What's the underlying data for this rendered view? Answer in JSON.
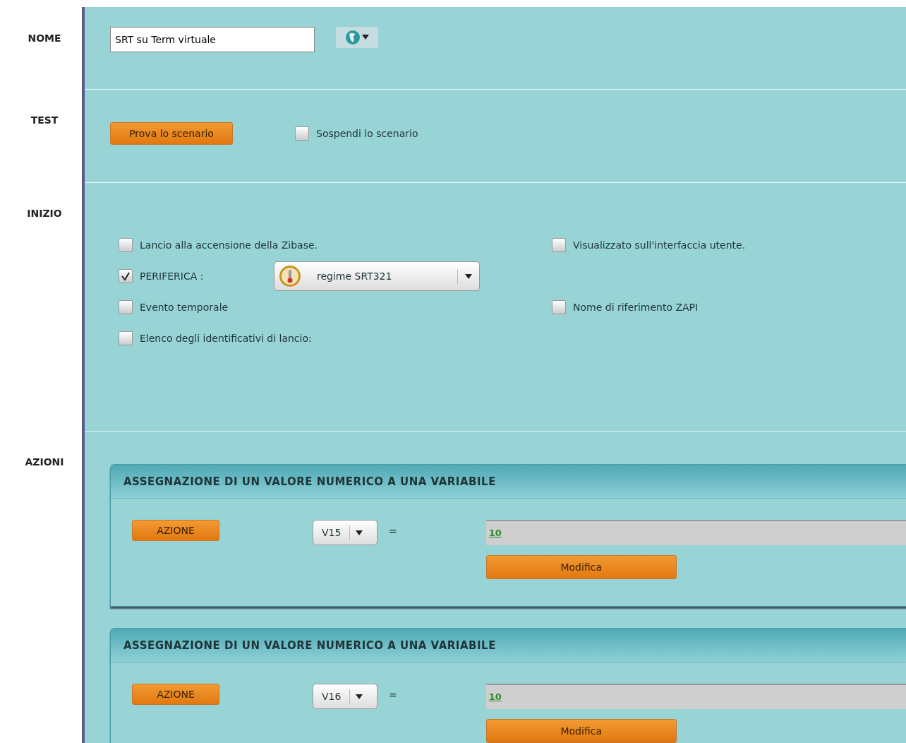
{
  "nome": {
    "label": "NOME",
    "value": "SRT su Term virtuale"
  },
  "test": {
    "label": "TEST",
    "button": "Prova lo scenario",
    "suspend": {
      "label": "Sospendi lo scenario",
      "checked": false
    }
  },
  "inizio": {
    "label": "INIZIO",
    "rows": [
      [
        {
          "kind": "plain",
          "label": "Lancio alla accensione della Zibase.",
          "checked": false
        },
        {
          "kind": "plain",
          "label": "Visualizzato sull'interfaccia utente.",
          "checked": false
        }
      ],
      [
        {
          "kind": "device",
          "label": "PERIFERICA :",
          "checked": true,
          "device": "regime SRT321"
        }
      ],
      [
        {
          "kind": "plain",
          "label": "Evento temporale",
          "checked": false
        },
        {
          "kind": "plain",
          "label": "Nome di riferimento ZAPI",
          "checked": false
        }
      ],
      [
        {
          "kind": "plain",
          "label": "Elenco degli identificativi di lancio:",
          "checked": false
        }
      ]
    ]
  },
  "azioni": {
    "label": "AZIONI",
    "actions": [
      {
        "title": "ASSEGNAZIONE  DI UN VALORE NUMERICO A UNA VARIABILE",
        "button": "AZIONE",
        "variable": "V15",
        "operator": "=",
        "value": "10",
        "modify": "Modifica"
      },
      {
        "title": "ASSEGNAZIONE  DI UN VALORE NUMERICO A UNA VARIABILE",
        "button": "AZIONE",
        "variable": "V16",
        "operator": "=",
        "value": "10",
        "modify": "Modifica"
      }
    ]
  }
}
